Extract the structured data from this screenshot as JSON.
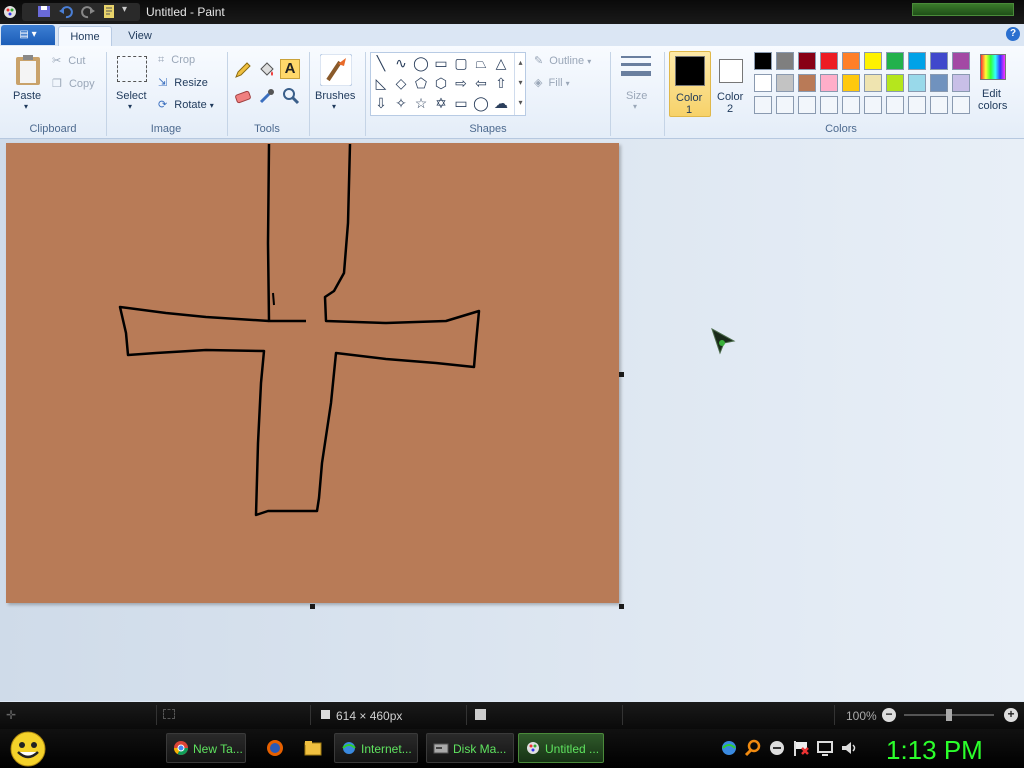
{
  "window": {
    "title": "Untitled - Paint"
  },
  "tabs": {
    "app_menu": "▤ ▾",
    "home": "Home",
    "view": "View",
    "help": "?"
  },
  "clipboard": {
    "paste": "Paste",
    "cut": "Cut",
    "copy": "Copy",
    "group": "Clipboard"
  },
  "image": {
    "select": "Select",
    "crop": "Crop",
    "resize": "Resize",
    "rotate": "Rotate",
    "group": "Image"
  },
  "tools": {
    "group": "Tools",
    "text": "A"
  },
  "brushes": {
    "label": "Brushes"
  },
  "shapes": {
    "outline": "Outline",
    "fill": "Fill",
    "group": "Shapes"
  },
  "size": {
    "label": "Size"
  },
  "colors": {
    "color1": "Color",
    "color1_num": "1",
    "color2": "Color",
    "color2_num": "2",
    "edit": "Edit",
    "edit2": "colors",
    "group": "Colors",
    "color1_value": "#000000",
    "color2_value": "#ffffff",
    "palette_row1": [
      "#000000",
      "#7f7f7f",
      "#880015",
      "#ed1c24",
      "#ff7f27",
      "#fff200",
      "#22b14c",
      "#00a2e8",
      "#3f48cc",
      "#a349a4"
    ],
    "palette_row2": [
      "#ffffff",
      "#c3c3c3",
      "#b97a57",
      "#ffaec9",
      "#ffc90e",
      "#efe4b0",
      "#b5e61d",
      "#99d9ea",
      "#7092be",
      "#c8bfe7"
    ],
    "canvas_color": "#b87b57"
  },
  "status": {
    "dimensions": "614 × 460px",
    "zoom": "100%"
  },
  "taskbar": {
    "items": [
      "New Ta...",
      "Internet...",
      "Disk Ma...",
      "Untitled ..."
    ],
    "clock": "1:13 PM"
  }
}
